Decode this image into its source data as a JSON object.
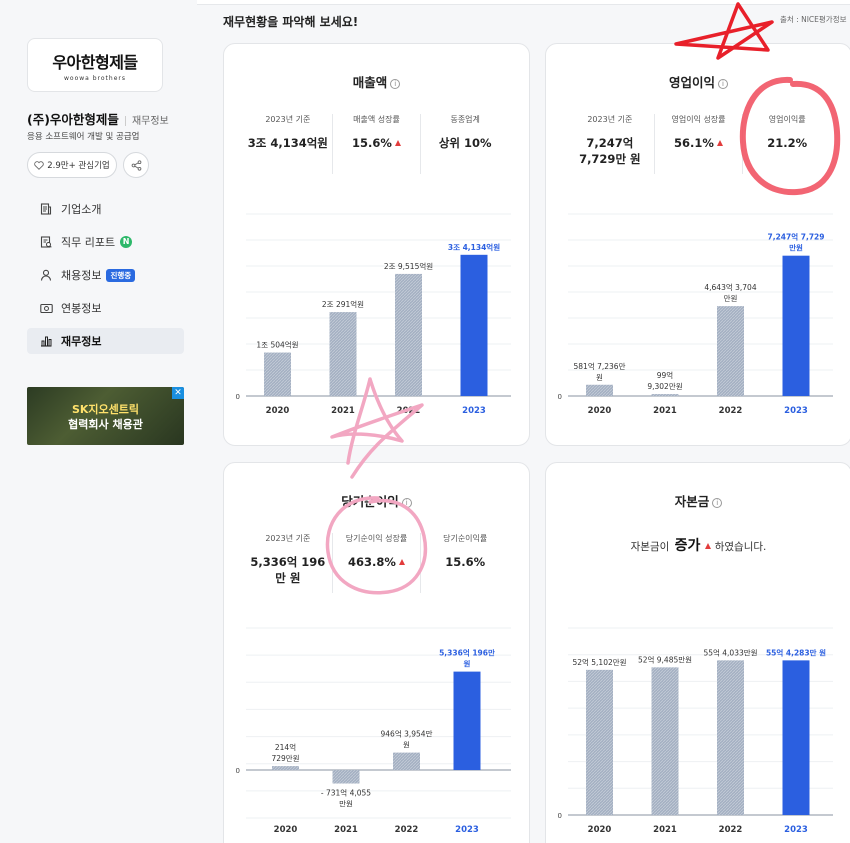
{
  "sidebar": {
    "logo_text": "우아한형제들",
    "logo_sub": "woowa brothers",
    "company_name": "(주)우아한형제들",
    "company_tag": "재무정보",
    "company_desc": "응용 소프트웨어 개발 및 공급업",
    "follow_label": "2.9만+ 관심기업",
    "nav": [
      {
        "label": "기업소개",
        "icon": "document-icon"
      },
      {
        "label": "직무 리포트",
        "icon": "report-icon",
        "badge": "N"
      },
      {
        "label": "채용정보",
        "icon": "person-icon",
        "badge": "진행중"
      },
      {
        "label": "연봉정보",
        "icon": "money-icon"
      },
      {
        "label": "재무정보",
        "icon": "bar-chart-icon",
        "active": true
      }
    ],
    "ad": {
      "line1": "SK지오센트릭",
      "line2": "협력회사 채용관",
      "close": "✕"
    }
  },
  "main": {
    "section_title": "재무현황을 파악해 보세요!",
    "source": "출처 : NICE평가정보"
  },
  "cards": {
    "revenue": {
      "title": "매출액",
      "stats": [
        {
          "label": "2023년 기준",
          "value": "3조 4,134억원"
        },
        {
          "label": "매출액 성장률",
          "value": "15.6%",
          "up": true
        },
        {
          "label": "동종업계",
          "value": "상위 10%"
        }
      ]
    },
    "operating": {
      "title": "영업이익",
      "stats": [
        {
          "label": "2023년 기준",
          "value": "7,247억 7,729만 원"
        },
        {
          "label": "영업이익 성장률",
          "value": "56.1%",
          "up": true
        },
        {
          "label": "영업이익률",
          "value": "21.2%"
        }
      ]
    },
    "net": {
      "title": "당기순이익",
      "stats": [
        {
          "label": "2023년 기준",
          "value": "5,336억 196만 원"
        },
        {
          "label": "당기순이익 성장률",
          "value": "463.8%",
          "up": true
        },
        {
          "label": "당기순이익률",
          "value": "15.6%"
        }
      ]
    },
    "capital": {
      "title": "자본금",
      "sentence_pre": "자본금이",
      "sentence_big": "증가",
      "sentence_post": "하였습니다."
    }
  },
  "chart_data": [
    {
      "type": "bar",
      "categories": [
        "2020",
        "2021",
        "2022",
        "2023"
      ],
      "values": [
        10504,
        20291,
        29515,
        34134
      ],
      "data_labels": [
        "1조 504억원",
        "2조 291억원",
        "2조 9,515억원",
        "3조 4,134억원"
      ],
      "ylim": [
        0,
        44000
      ],
      "y_tick_labels": [
        "0"
      ],
      "highlight_last": true,
      "label_lines": 1
    },
    {
      "type": "bar",
      "categories": [
        "2020",
        "2021",
        "2022",
        "2023"
      ],
      "values": [
        581,
        99,
        4643,
        7247
      ],
      "data_labels": [
        "581억 7,236만 원",
        "99억 9,302만원",
        "4,643억 3,704 만원",
        "7,247억 7,729 만원"
      ],
      "ylim": [
        0,
        9400
      ],
      "y_tick_labels": [
        "0"
      ],
      "highlight_last": true,
      "label_lines": 2
    },
    {
      "type": "bar",
      "categories": [
        "2020",
        "2021",
        "2022",
        "2023"
      ],
      "values": [
        214,
        -731,
        946,
        5336
      ],
      "data_labels": [
        "214억 729만원",
        "- 731억 4,055 만원",
        "946억 3,954만 원",
        "5,336억 196만 원"
      ],
      "ylim": [
        -2600,
        7700
      ],
      "y_tick_labels": [
        "0"
      ],
      "highlight_last": true,
      "label_lines": 2
    },
    {
      "type": "bar",
      "categories": [
        "2020",
        "2021",
        "2022",
        "2023"
      ],
      "values": [
        52,
        52.9,
        55.4,
        55.4
      ],
      "data_labels": [
        "52억 5,102만원",
        "52억 9,485만원",
        "55억 4,033만원",
        "55억 4,283만 원"
      ],
      "ylim": [
        0,
        67
      ],
      "y_tick_labels": [
        "0"
      ],
      "highlight_last": true,
      "label_lines": 1
    }
  ]
}
